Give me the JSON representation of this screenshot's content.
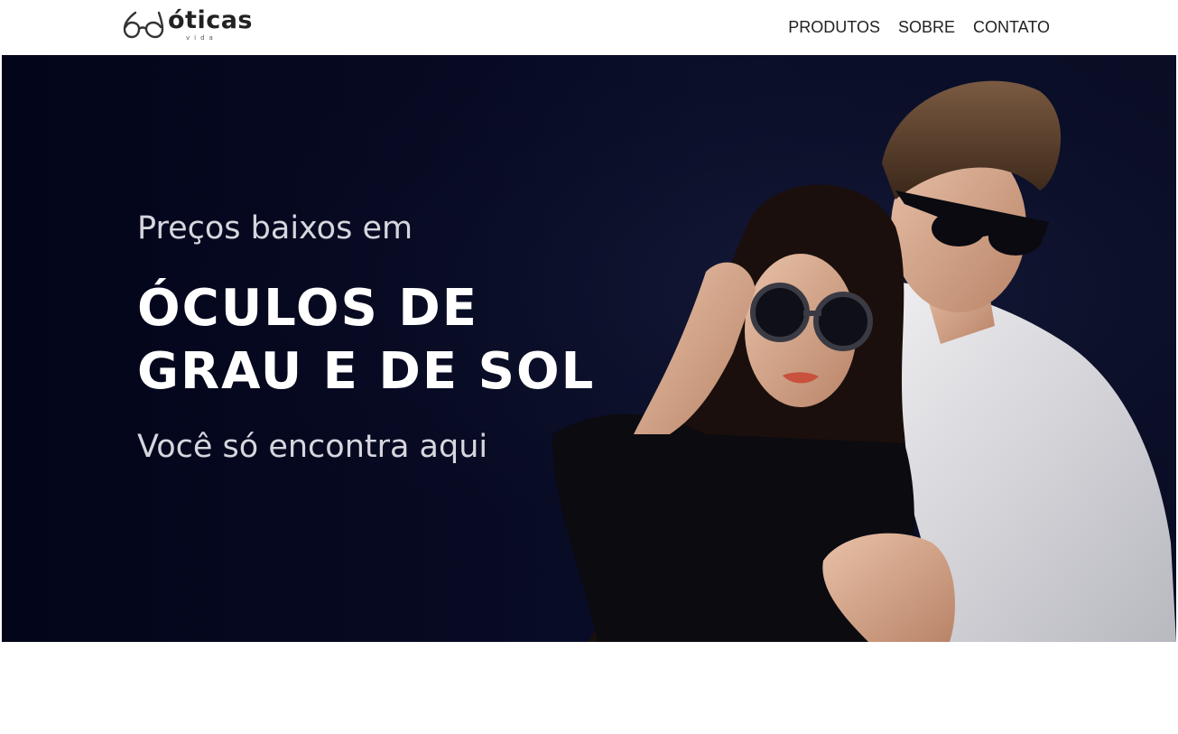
{
  "brand": {
    "name": "óticas",
    "tagline": "vida",
    "logo_icon": "glasses-icon"
  },
  "nav": {
    "items": [
      "PRODUTOS",
      "SOBRE",
      "CONTATO"
    ]
  },
  "hero": {
    "pre_heading": "Preços baixos em",
    "headline_line1": "ÓCULOS DE",
    "headline_line2": "GRAU E DE SOL",
    "sub_heading": "Você só encontra aqui",
    "image": "couple-wearing-sunglasses-photo"
  },
  "colors": {
    "hero_background": "#05081f",
    "text_white": "#ffffff",
    "text_muted": "#d6d6de",
    "nav_text": "#222222"
  }
}
